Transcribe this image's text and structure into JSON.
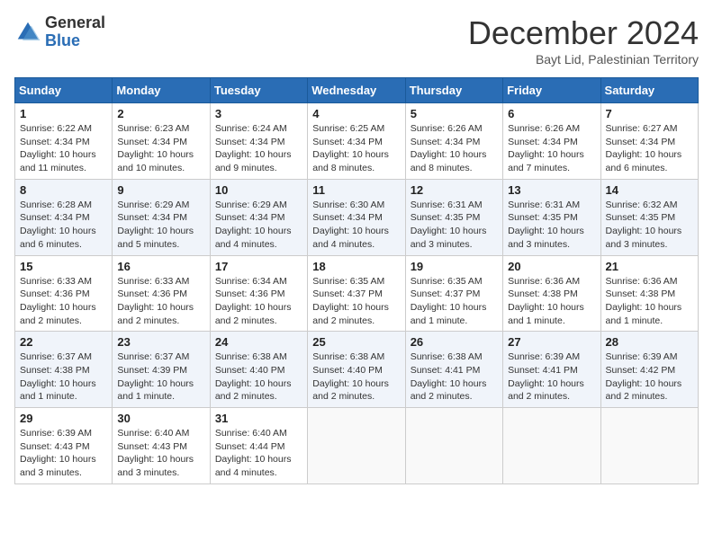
{
  "logo": {
    "general": "General",
    "blue": "Blue"
  },
  "header": {
    "month": "December 2024",
    "location": "Bayt Lid, Palestinian Territory"
  },
  "days_of_week": [
    "Sunday",
    "Monday",
    "Tuesday",
    "Wednesday",
    "Thursday",
    "Friday",
    "Saturday"
  ],
  "weeks": [
    [
      {
        "day": "1",
        "sunrise": "6:22 AM",
        "sunset": "4:34 PM",
        "daylight": "10 hours and 11 minutes."
      },
      {
        "day": "2",
        "sunrise": "6:23 AM",
        "sunset": "4:34 PM",
        "daylight": "10 hours and 10 minutes."
      },
      {
        "day": "3",
        "sunrise": "6:24 AM",
        "sunset": "4:34 PM",
        "daylight": "10 hours and 9 minutes."
      },
      {
        "day": "4",
        "sunrise": "6:25 AM",
        "sunset": "4:34 PM",
        "daylight": "10 hours and 8 minutes."
      },
      {
        "day": "5",
        "sunrise": "6:26 AM",
        "sunset": "4:34 PM",
        "daylight": "10 hours and 8 minutes."
      },
      {
        "day": "6",
        "sunrise": "6:26 AM",
        "sunset": "4:34 PM",
        "daylight": "10 hours and 7 minutes."
      },
      {
        "day": "7",
        "sunrise": "6:27 AM",
        "sunset": "4:34 PM",
        "daylight": "10 hours and 6 minutes."
      }
    ],
    [
      {
        "day": "8",
        "sunrise": "6:28 AM",
        "sunset": "4:34 PM",
        "daylight": "10 hours and 6 minutes."
      },
      {
        "day": "9",
        "sunrise": "6:29 AM",
        "sunset": "4:34 PM",
        "daylight": "10 hours and 5 minutes."
      },
      {
        "day": "10",
        "sunrise": "6:29 AM",
        "sunset": "4:34 PM",
        "daylight": "10 hours and 4 minutes."
      },
      {
        "day": "11",
        "sunrise": "6:30 AM",
        "sunset": "4:34 PM",
        "daylight": "10 hours and 4 minutes."
      },
      {
        "day": "12",
        "sunrise": "6:31 AM",
        "sunset": "4:35 PM",
        "daylight": "10 hours and 3 minutes."
      },
      {
        "day": "13",
        "sunrise": "6:31 AM",
        "sunset": "4:35 PM",
        "daylight": "10 hours and 3 minutes."
      },
      {
        "day": "14",
        "sunrise": "6:32 AM",
        "sunset": "4:35 PM",
        "daylight": "10 hours and 3 minutes."
      }
    ],
    [
      {
        "day": "15",
        "sunrise": "6:33 AM",
        "sunset": "4:36 PM",
        "daylight": "10 hours and 2 minutes."
      },
      {
        "day": "16",
        "sunrise": "6:33 AM",
        "sunset": "4:36 PM",
        "daylight": "10 hours and 2 minutes."
      },
      {
        "day": "17",
        "sunrise": "6:34 AM",
        "sunset": "4:36 PM",
        "daylight": "10 hours and 2 minutes."
      },
      {
        "day": "18",
        "sunrise": "6:35 AM",
        "sunset": "4:37 PM",
        "daylight": "10 hours and 2 minutes."
      },
      {
        "day": "19",
        "sunrise": "6:35 AM",
        "sunset": "4:37 PM",
        "daylight": "10 hours and 1 minute."
      },
      {
        "day": "20",
        "sunrise": "6:36 AM",
        "sunset": "4:38 PM",
        "daylight": "10 hours and 1 minute."
      },
      {
        "day": "21",
        "sunrise": "6:36 AM",
        "sunset": "4:38 PM",
        "daylight": "10 hours and 1 minute."
      }
    ],
    [
      {
        "day": "22",
        "sunrise": "6:37 AM",
        "sunset": "4:38 PM",
        "daylight": "10 hours and 1 minute."
      },
      {
        "day": "23",
        "sunrise": "6:37 AM",
        "sunset": "4:39 PM",
        "daylight": "10 hours and 1 minute."
      },
      {
        "day": "24",
        "sunrise": "6:38 AM",
        "sunset": "4:40 PM",
        "daylight": "10 hours and 2 minutes."
      },
      {
        "day": "25",
        "sunrise": "6:38 AM",
        "sunset": "4:40 PM",
        "daylight": "10 hours and 2 minutes."
      },
      {
        "day": "26",
        "sunrise": "6:38 AM",
        "sunset": "4:41 PM",
        "daylight": "10 hours and 2 minutes."
      },
      {
        "day": "27",
        "sunrise": "6:39 AM",
        "sunset": "4:41 PM",
        "daylight": "10 hours and 2 minutes."
      },
      {
        "day": "28",
        "sunrise": "6:39 AM",
        "sunset": "4:42 PM",
        "daylight": "10 hours and 2 minutes."
      }
    ],
    [
      {
        "day": "29",
        "sunrise": "6:39 AM",
        "sunset": "4:43 PM",
        "daylight": "10 hours and 3 minutes."
      },
      {
        "day": "30",
        "sunrise": "6:40 AM",
        "sunset": "4:43 PM",
        "daylight": "10 hours and 3 minutes."
      },
      {
        "day": "31",
        "sunrise": "6:40 AM",
        "sunset": "4:44 PM",
        "daylight": "10 hours and 4 minutes."
      },
      null,
      null,
      null,
      null
    ]
  ]
}
